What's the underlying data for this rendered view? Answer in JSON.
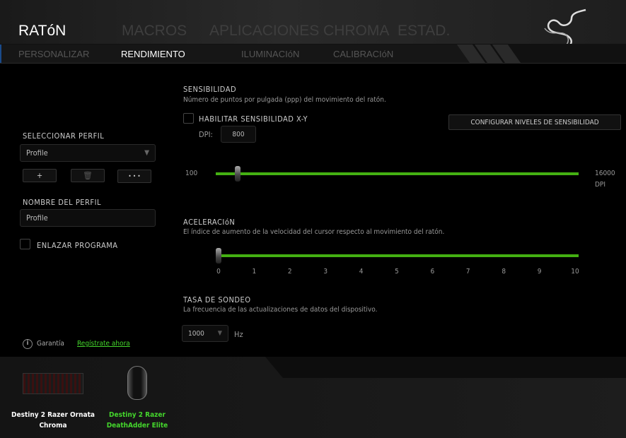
{
  "header": {
    "tabs": [
      {
        "label": "RATóN",
        "active": true
      },
      {
        "label": "MACROS"
      },
      {
        "label": "APLICACIONES CHROMA"
      },
      {
        "label": "ESTAD."
      }
    ],
    "logo": "razer-logo"
  },
  "subnav": {
    "tabs": [
      {
        "label": "PERSONALIZAR"
      },
      {
        "label": "RENDIMIENTO",
        "active": true
      },
      {
        "label": "ILUMINACIóN"
      },
      {
        "label": "CALIBRACIóN"
      }
    ]
  },
  "sidebar": {
    "select_profile_label": "SELECCIONAR PERFIL",
    "profile_value": "Profile",
    "add_label": "+",
    "delete_icon": "trash-icon",
    "more_label": "• • •",
    "profile_name_label": "NOMBRE DEL PERFIL",
    "profile_name_value": "Profile",
    "link_program_label": "ENLAZAR PROGRAMA",
    "link_program_checked": false,
    "warranty_label": "Garantía",
    "register_link": "Regístrate ahora"
  },
  "sensitivity": {
    "title": "SENSIBILIDAD",
    "desc": "Número de puntos por pulgada (ppp) del movimiento del ratón.",
    "xy_label": "HABILITAR SENSIBILIDAD X-Y",
    "xy_checked": false,
    "dpi_label": "DPI:",
    "dpi_value": "800",
    "config_button": "CONFIGURAR NIVELES DE SENSIBILIDAD",
    "min": "100",
    "max": "16000",
    "unit": "DPI",
    "value": 800
  },
  "acceleration": {
    "title": "ACELERACIóN",
    "desc": "El índice de aumento de la velocidad del cursor respecto al movimiento del ratón.",
    "ticks": [
      "0",
      "1",
      "2",
      "3",
      "4",
      "5",
      "6",
      "7",
      "8",
      "9",
      "10"
    ],
    "value": 0
  },
  "polling": {
    "title": "TASA DE SONDEO",
    "desc": "La frecuencia de las actualizaciones de datos del dispositivo.",
    "value": "1000",
    "unit": "Hz"
  },
  "devices": [
    {
      "name_line1": "Destiny 2 Razer Ornata",
      "name_line2": "Chroma",
      "selected": false
    },
    {
      "name_line1": "Destiny 2 Razer",
      "name_line2": "DeathAdder Elite",
      "selected": true
    }
  ],
  "colors": {
    "accent": "#44d62c",
    "track": "#44b012"
  }
}
